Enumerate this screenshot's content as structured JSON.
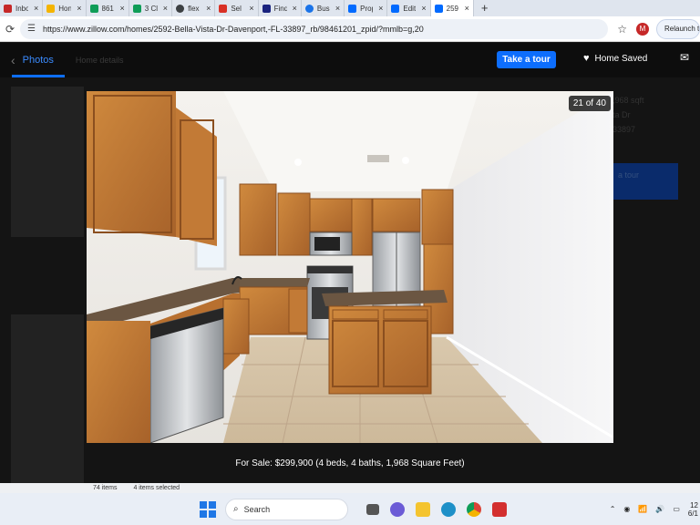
{
  "browser": {
    "tabs": [
      {
        "label": "Inbo",
        "color": "#c62828"
      },
      {
        "label": "Hon",
        "color": "#f4b400"
      },
      {
        "label": "861",
        "color": "#0f9d58"
      },
      {
        "label": "3 Cl",
        "color": "#0f9d58"
      },
      {
        "label": "flex",
        "color": "#3c4043"
      },
      {
        "label": "Sel",
        "color": "#d93025"
      },
      {
        "label": "Find",
        "color": "#1a237e"
      },
      {
        "label": "Bus",
        "color": "#1a73e8"
      },
      {
        "label": "Prop",
        "color": "#006aff"
      },
      {
        "label": "Edit",
        "color": "#006aff"
      },
      {
        "label": "259",
        "color": "#006aff"
      }
    ],
    "new_tab": "+",
    "url": "https://www.zillow.com/homes/2592-Bella-Vista-Dr-Davenport,-FL-33897_rb/98461201_zpid/?mmlb=g,20",
    "profile_initial": "M",
    "relaunch_label": "Relaunch t"
  },
  "viewer": {
    "tab_photos": "Photos",
    "behind_text": "Home details",
    "take_tour": "Take a tour",
    "home_saved": "Home Saved",
    "counter": "21 of 40",
    "caption": "For Sale: $299,900 (4 beds, 4 baths, 1,968 Square Feet)",
    "right_sqft": ",968 sqft",
    "right_addr1": "ta Dr",
    "right_addr2": "33897",
    "right_btn": "a tour"
  },
  "explorer_status": {
    "items": "74 items",
    "selected": "4 items selected"
  },
  "taskbar": {
    "search_placeholder": "Search",
    "clock_time": "12",
    "clock_date": "6/1"
  }
}
